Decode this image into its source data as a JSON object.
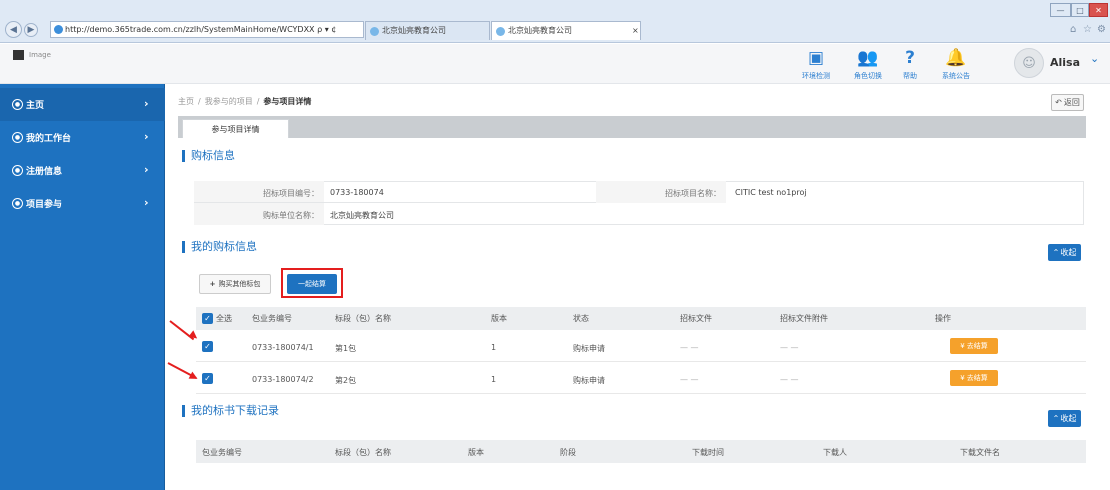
{
  "browser": {
    "url": "http://demo.365trade.com.cn/zzlh/SystemMainHome/WCYDXX",
    "url_controls": "ρ ▾ ¢",
    "tabs": [
      {
        "title": "北京灿亮教育公司"
      },
      {
        "title": "北京灿亮教育公司",
        "close": "×"
      }
    ],
    "window_buttons": [
      "—",
      "□",
      "✕"
    ]
  },
  "header": {
    "logo_text": "Image",
    "icons": [
      {
        "icon": "environment-check-icon",
        "label": "环境检测"
      },
      {
        "icon": "role-switch-icon",
        "label": "角色切换"
      },
      {
        "icon": "help-icon",
        "label": "帮助"
      },
      {
        "icon": "bell-icon",
        "label": "系统公告"
      }
    ],
    "user": "Alisa",
    "user_caret": "⌄"
  },
  "sidebar": {
    "items": [
      {
        "label": "主页",
        "active": true
      },
      {
        "label": "我的工作台"
      },
      {
        "label": "注册信息"
      },
      {
        "label": "项目参与"
      }
    ]
  },
  "breadcrumb": {
    "items": [
      "主页",
      "我参与的项目"
    ],
    "current": "参与项目详情",
    "separator": "/"
  },
  "back_label": "返回",
  "tab": {
    "label": "参与项目详情"
  },
  "sections": {
    "purchase_info": {
      "title": "购标信息",
      "fields": {
        "project_no_label": "招标项目编号：",
        "project_no": "0733-180074",
        "project_name_label": "招标项目名称：",
        "project_name": "CITIC test no1proj",
        "buyer_label": "购标单位名称：",
        "buyer": "北京灿亮教育公司"
      }
    },
    "my_purchase": {
      "title": "我的购标信息",
      "collapse": "收起",
      "buy_more": "购买其他标包",
      "settle_all": "一起结算",
      "headers": [
        "全选",
        "包业务编号",
        "标段（包）名称",
        "版本",
        "状态",
        "招标文件",
        "招标文件附件",
        "操作"
      ],
      "rows": [
        {
          "id": "0733-180074/1",
          "name": "第1包",
          "version": "1",
          "status": "购标申请",
          "file": "— —",
          "attachment": "— —",
          "action": "去结算"
        },
        {
          "id": "0733-180074/2",
          "name": "第2包",
          "version": "1",
          "status": "购标申请",
          "file": "— —",
          "attachment": "— —",
          "action": "去结算"
        }
      ]
    },
    "downloads": {
      "title": "我的标书下载记录",
      "collapse": "收起",
      "headers": [
        "包业务编号",
        "标段（包）名称",
        "版本",
        "阶段",
        "下载时间",
        "下载人",
        "下载文件名"
      ]
    }
  },
  "colors": {
    "primary": "#1e72c0",
    "action": "#f5a12b",
    "annotation": "#e41e1e"
  }
}
